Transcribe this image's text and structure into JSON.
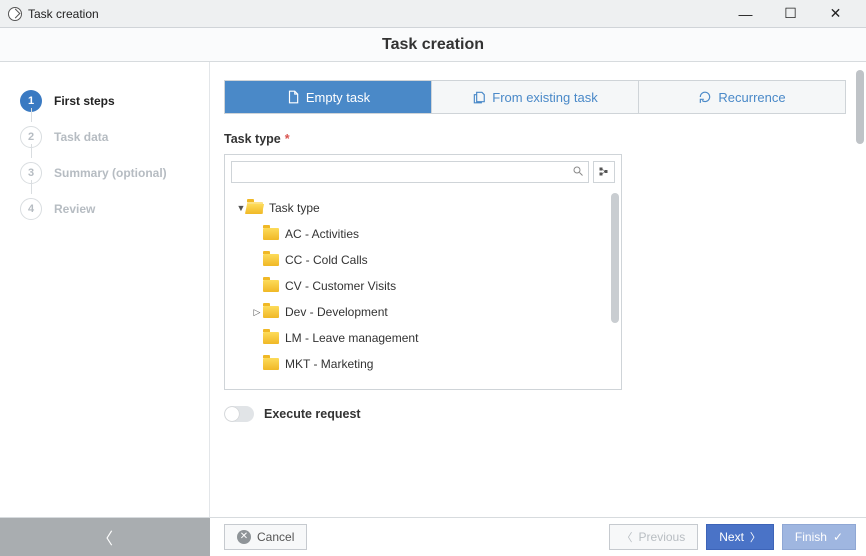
{
  "window": {
    "title": "Task creation"
  },
  "header": {
    "title": "Task creation"
  },
  "steps": [
    {
      "num": "1",
      "label": "First steps",
      "active": true
    },
    {
      "num": "2",
      "label": "Task data",
      "active": false
    },
    {
      "num": "3",
      "label": "Summary (optional)",
      "active": false
    },
    {
      "num": "4",
      "label": "Review",
      "active": false
    }
  ],
  "tabs": {
    "empty": "Empty task",
    "existing": "From existing task",
    "recurrence": "Recurrence"
  },
  "task_type": {
    "label": "Task type",
    "search_placeholder": "",
    "tree": {
      "root": "Task type",
      "items": [
        {
          "label": "AC - Activities",
          "expandable": false
        },
        {
          "label": "CC - Cold Calls",
          "expandable": false
        },
        {
          "label": "CV - Customer Visits",
          "expandable": false
        },
        {
          "label": "Dev - Development",
          "expandable": true
        },
        {
          "label": "LM - Leave management",
          "expandable": false
        },
        {
          "label": "MKT - Marketing",
          "expandable": false
        }
      ]
    }
  },
  "toggle": {
    "label": "Execute request",
    "on": false
  },
  "footer": {
    "cancel": "Cancel",
    "previous": "Previous",
    "next": "Next",
    "finish": "Finish"
  }
}
